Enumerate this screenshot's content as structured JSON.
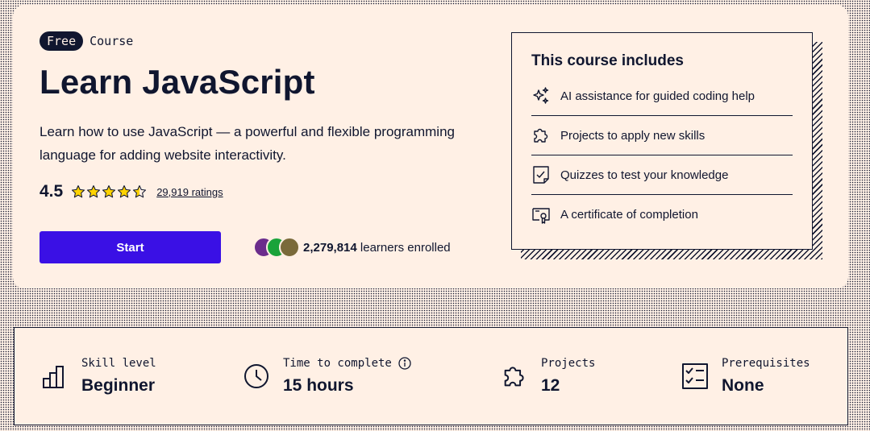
{
  "hero": {
    "badge": "Free",
    "type_label": "Course",
    "title": "Learn JavaScript",
    "description": "Learn how to use JavaScript — a powerful and flexible programming language for adding website interactivity.",
    "rating": "4.5",
    "rating_stars": 4.5,
    "ratings_count": "29,919 ratings",
    "start_label": "Start",
    "learners_count": "2,279,814",
    "learners_suffix": " learners enrolled",
    "avatar_colors": [
      "#6b2d8c",
      "#1aa33a",
      "#7a6a3a"
    ]
  },
  "includes": {
    "title": "This course includes",
    "items": [
      {
        "icon": "sparkle-icon",
        "label": "AI assistance for guided coding help"
      },
      {
        "icon": "puzzle-icon",
        "label": "Projects to apply new skills"
      },
      {
        "icon": "quiz-icon",
        "label": "Quizzes to test your knowledge"
      },
      {
        "icon": "certificate-icon",
        "label": "A certificate of completion"
      }
    ]
  },
  "stats": [
    {
      "icon": "bar-chart-icon",
      "label": "Skill level",
      "value": "Beginner"
    },
    {
      "icon": "clock-icon",
      "label": "Time to complete",
      "value": "15 hours",
      "info_icon": "info-icon"
    },
    {
      "icon": "puzzle-icon",
      "label": "Projects",
      "value": "12"
    },
    {
      "icon": "checklist-icon",
      "label": "Prerequisites",
      "value": "None"
    }
  ],
  "colors": {
    "accent": "#3a10e5",
    "ink": "#10162f",
    "background": "#fff0e5",
    "star": "#ffd300"
  }
}
